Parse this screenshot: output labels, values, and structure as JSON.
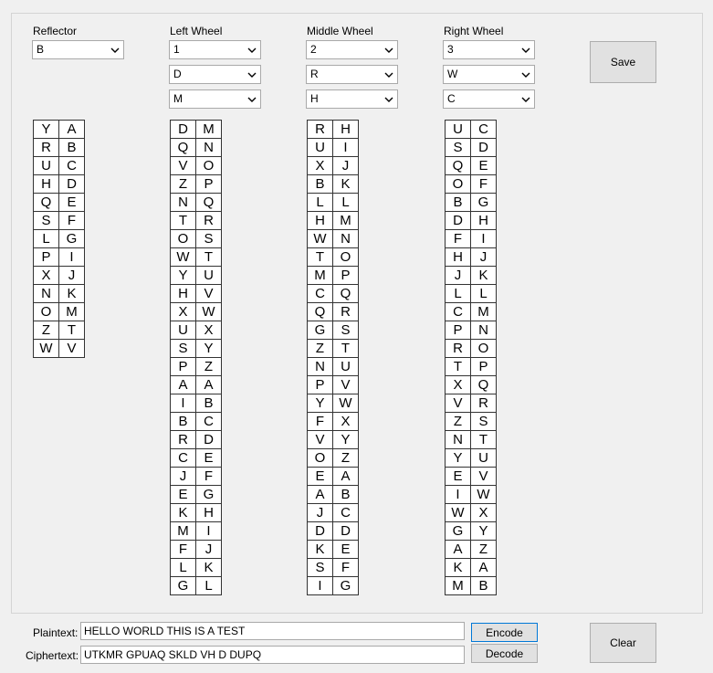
{
  "reflector": {
    "label": "Reflector",
    "value": "B",
    "pairs": [
      [
        "Y",
        "A"
      ],
      [
        "R",
        "B"
      ],
      [
        "U",
        "C"
      ],
      [
        "H",
        "D"
      ],
      [
        "Q",
        "E"
      ],
      [
        "S",
        "F"
      ],
      [
        "L",
        "G"
      ],
      [
        "P",
        "I"
      ],
      [
        "X",
        "J"
      ],
      [
        "N",
        "K"
      ],
      [
        "O",
        "M"
      ],
      [
        "Z",
        "T"
      ],
      [
        "W",
        "V"
      ]
    ]
  },
  "left_wheel": {
    "label": "Left Wheel",
    "rotor": "1",
    "position": "D",
    "ring": "M",
    "pairs": [
      [
        "D",
        "M"
      ],
      [
        "Q",
        "N"
      ],
      [
        "V",
        "O"
      ],
      [
        "Z",
        "P"
      ],
      [
        "N",
        "Q"
      ],
      [
        "T",
        "R"
      ],
      [
        "O",
        "S"
      ],
      [
        "W",
        "T"
      ],
      [
        "Y",
        "U"
      ],
      [
        "H",
        "V"
      ],
      [
        "X",
        "W"
      ],
      [
        "U",
        "X"
      ],
      [
        "S",
        "Y"
      ],
      [
        "P",
        "Z"
      ],
      [
        "A",
        "A"
      ],
      [
        "I",
        "B"
      ],
      [
        "B",
        "C"
      ],
      [
        "R",
        "D"
      ],
      [
        "C",
        "E"
      ],
      [
        "J",
        "F"
      ],
      [
        "E",
        "G"
      ],
      [
        "K",
        "H"
      ],
      [
        "M",
        "I"
      ],
      [
        "F",
        "J"
      ],
      [
        "L",
        "K"
      ],
      [
        "G",
        "L"
      ]
    ]
  },
  "middle_wheel": {
    "label": "Middle Wheel",
    "rotor": "2",
    "position": "R",
    "ring": "H",
    "pairs": [
      [
        "R",
        "H"
      ],
      [
        "U",
        "I"
      ],
      [
        "X",
        "J"
      ],
      [
        "B",
        "K"
      ],
      [
        "L",
        "L"
      ],
      [
        "H",
        "M"
      ],
      [
        "W",
        "N"
      ],
      [
        "T",
        "O"
      ],
      [
        "M",
        "P"
      ],
      [
        "C",
        "Q"
      ],
      [
        "Q",
        "R"
      ],
      [
        "G",
        "S"
      ],
      [
        "Z",
        "T"
      ],
      [
        "N",
        "U"
      ],
      [
        "P",
        "V"
      ],
      [
        "Y",
        "W"
      ],
      [
        "F",
        "X"
      ],
      [
        "V",
        "Y"
      ],
      [
        "O",
        "Z"
      ],
      [
        "E",
        "A"
      ],
      [
        "A",
        "B"
      ],
      [
        "J",
        "C"
      ],
      [
        "D",
        "D"
      ],
      [
        "K",
        "E"
      ],
      [
        "S",
        "F"
      ],
      [
        "I",
        "G"
      ]
    ]
  },
  "right_wheel": {
    "label": "Right Wheel",
    "rotor": "3",
    "position": "W",
    "ring": "C",
    "pairs": [
      [
        "U",
        "C"
      ],
      [
        "S",
        "D"
      ],
      [
        "Q",
        "E"
      ],
      [
        "O",
        "F"
      ],
      [
        "B",
        "G"
      ],
      [
        "D",
        "H"
      ],
      [
        "F",
        "I"
      ],
      [
        "H",
        "J"
      ],
      [
        "J",
        "K"
      ],
      [
        "L",
        "L"
      ],
      [
        "C",
        "M"
      ],
      [
        "P",
        "N"
      ],
      [
        "R",
        "O"
      ],
      [
        "T",
        "P"
      ],
      [
        "X",
        "Q"
      ],
      [
        "V",
        "R"
      ],
      [
        "Z",
        "S"
      ],
      [
        "N",
        "T"
      ],
      [
        "Y",
        "U"
      ],
      [
        "E",
        "V"
      ],
      [
        "I",
        "W"
      ],
      [
        "W",
        "X"
      ],
      [
        "G",
        "Y"
      ],
      [
        "A",
        "Z"
      ],
      [
        "K",
        "A"
      ],
      [
        "M",
        "B"
      ]
    ]
  },
  "buttons": {
    "save": "Save",
    "encode": "Encode",
    "decode": "Decode",
    "clear": "Clear"
  },
  "plaintext": {
    "label": "Plaintext:",
    "value": "HELLO WORLD THIS IS A TEST"
  },
  "ciphertext": {
    "label": "Ciphertext:",
    "value": "UTKMR GPUAQ SKLD VH D DUPQ"
  }
}
